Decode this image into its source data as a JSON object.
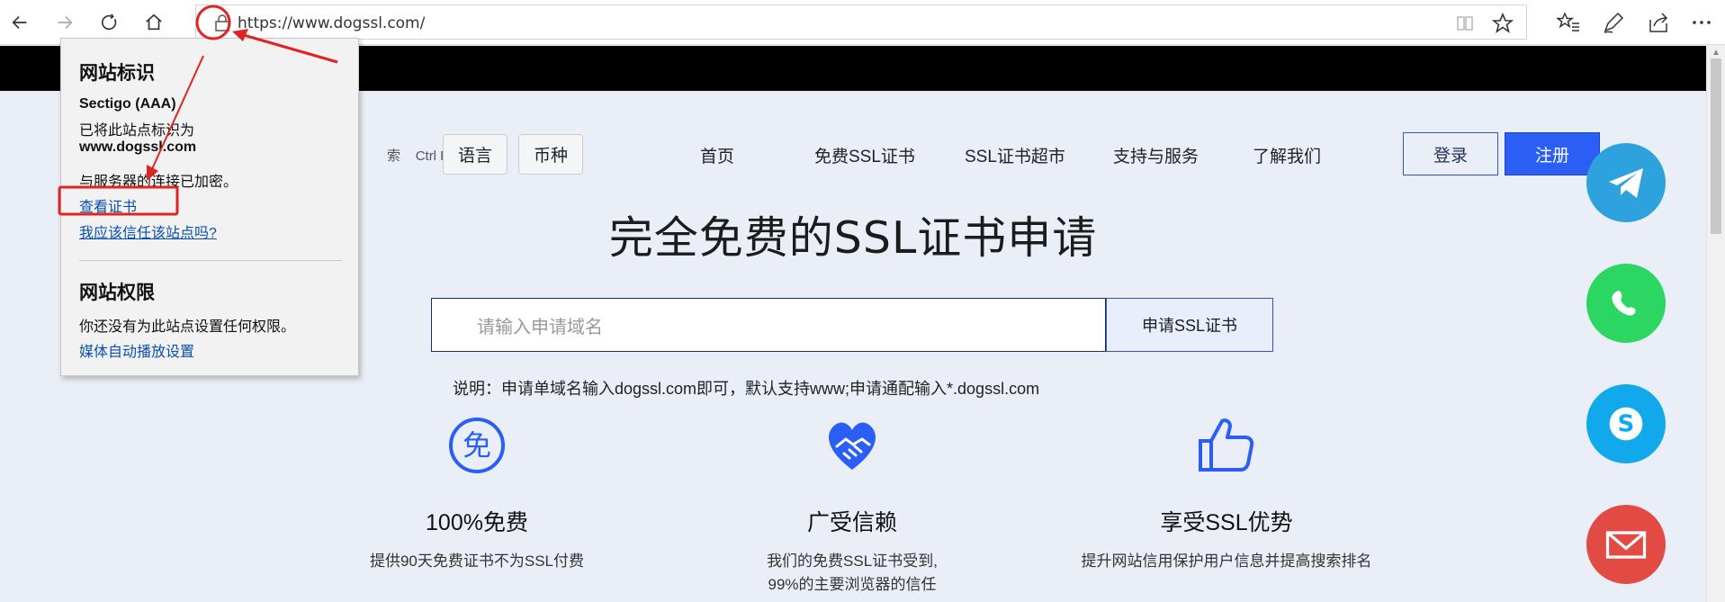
{
  "browser": {
    "url": "https://www.dogssl.com/"
  },
  "site": {
    "search_hint": "索",
    "search_shortcut": "Ctrl F",
    "language_btn": "语言",
    "currency_btn": "币种",
    "nav": [
      "首页",
      "免费SSL证书",
      "SSL证书超市",
      "支持与服务",
      "了解我们"
    ],
    "login": "登录",
    "register": "注册",
    "hero_title": "完全免费的SSL证书申请",
    "domain_placeholder": "请输入申请域名",
    "apply_button": "申请SSL证书",
    "note": "说明：申请单域名输入dogssl.com即可，默认支持www;申请通配输入*.dogssl.com",
    "features": [
      {
        "title": "100%免费",
        "desc_lines": [
          "提供90天免费证书不为SSL付费"
        ]
      },
      {
        "title": "广受信赖",
        "desc_lines": [
          "我们的免费SSL证书受到,",
          "99%的主要浏览器的信任"
        ]
      },
      {
        "title": "享受SSL优势",
        "desc_lines": [
          "提升网站信用保护用户信息并提高搜索排名"
        ]
      }
    ],
    "social_colors": {
      "telegram": "#2ea2dc",
      "whatsapp": "#2bd663",
      "skype": "#12a9ec",
      "email": "#e14b43"
    }
  },
  "popup": {
    "identity_title": "网站标识",
    "issuer": "Sectigo (AAA)",
    "identified_as": "已将此站点标识为",
    "domain": "www.dogssl.com",
    "encrypted": "与服务器的连接已加密。",
    "view_cert": "查看证书",
    "trust_link": "我应该信任该站点吗?",
    "permissions_title": "网站权限",
    "permissions_text": "你还没有为此站点设置任何权限。",
    "media_link": "媒体自动播放设置"
  },
  "colors": {
    "annotation_red": "#e02424",
    "accent_blue": "#2a5ef5"
  }
}
